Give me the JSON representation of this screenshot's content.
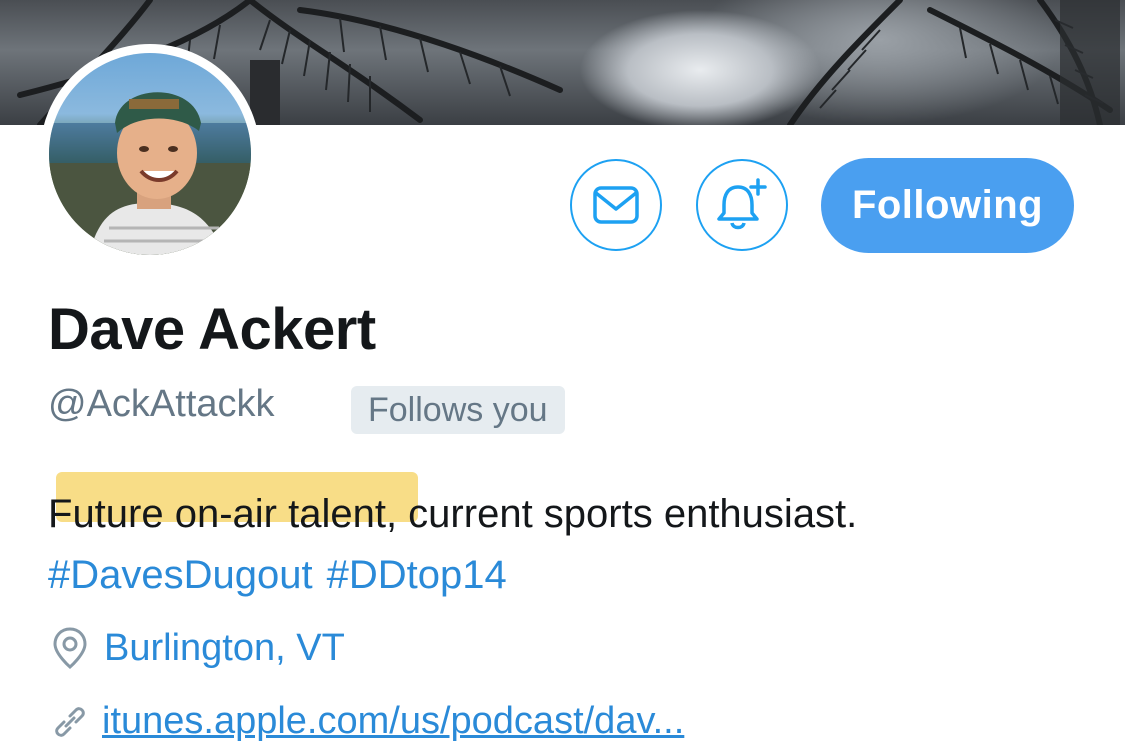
{
  "profile": {
    "display_name": "Dave Ackert",
    "handle": "@AckAttackk",
    "follows_badge": "Follows you",
    "bio_text_prefix": "F",
    "bio_text_highlighted": "uture on-air talen",
    "bio_text_suffix": "t, current sports enthusiast.",
    "hashtags": [
      "#DavesDugout",
      "#DDtop14"
    ],
    "location": "Burlington, VT",
    "website": "itunes.apple.com/us/podcast/dav..."
  },
  "actions": {
    "message_icon": "envelope-icon",
    "notify_icon": "bell-plus-icon",
    "following_label": "Following"
  },
  "colors": {
    "accent": "#1da1f2",
    "following_bg": "#4a9ff0",
    "muted_text": "#657786",
    "badge_bg": "#e6ecf0",
    "highlight": "#f6d25f"
  }
}
